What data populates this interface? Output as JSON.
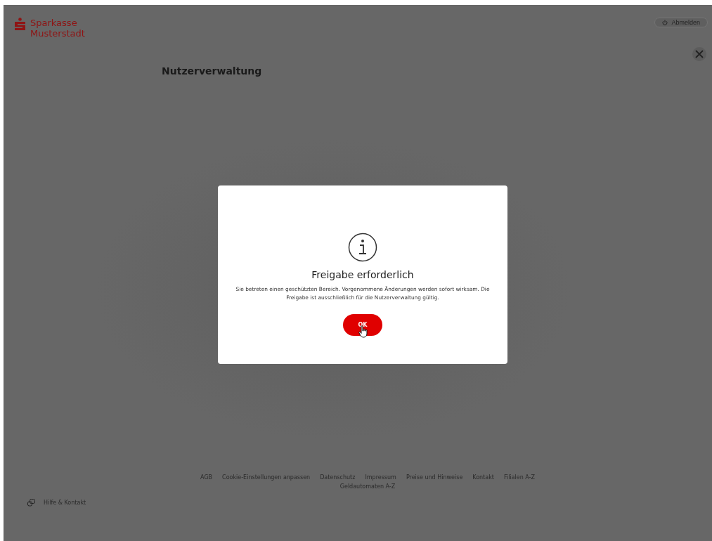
{
  "header": {
    "brand_line_1": "Sparkasse",
    "brand_line_2": "Musterstadt",
    "logout": "Abmelden"
  },
  "page": {
    "title": "Nutzerverwaltung"
  },
  "dialog": {
    "title": "Freigabe erforderlich",
    "message": "Sie betreten einen geschützten Bereich. Vorgenommene Änderungen werden sofort wirksam. Die Freigabe ist ausschließlich für die Nutzerverwaltung gültig.",
    "button": "OK"
  },
  "footer": {
    "help": "Hilfe & Kontakt",
    "links": [
      "AGB",
      "Cookie-Einstellungen anpassen",
      "Datenschutz",
      "Impressum",
      "Preise und Hinweise",
      "Kontakt",
      "Filialen A-Z",
      "Geldautomaten A-Z"
    ]
  }
}
